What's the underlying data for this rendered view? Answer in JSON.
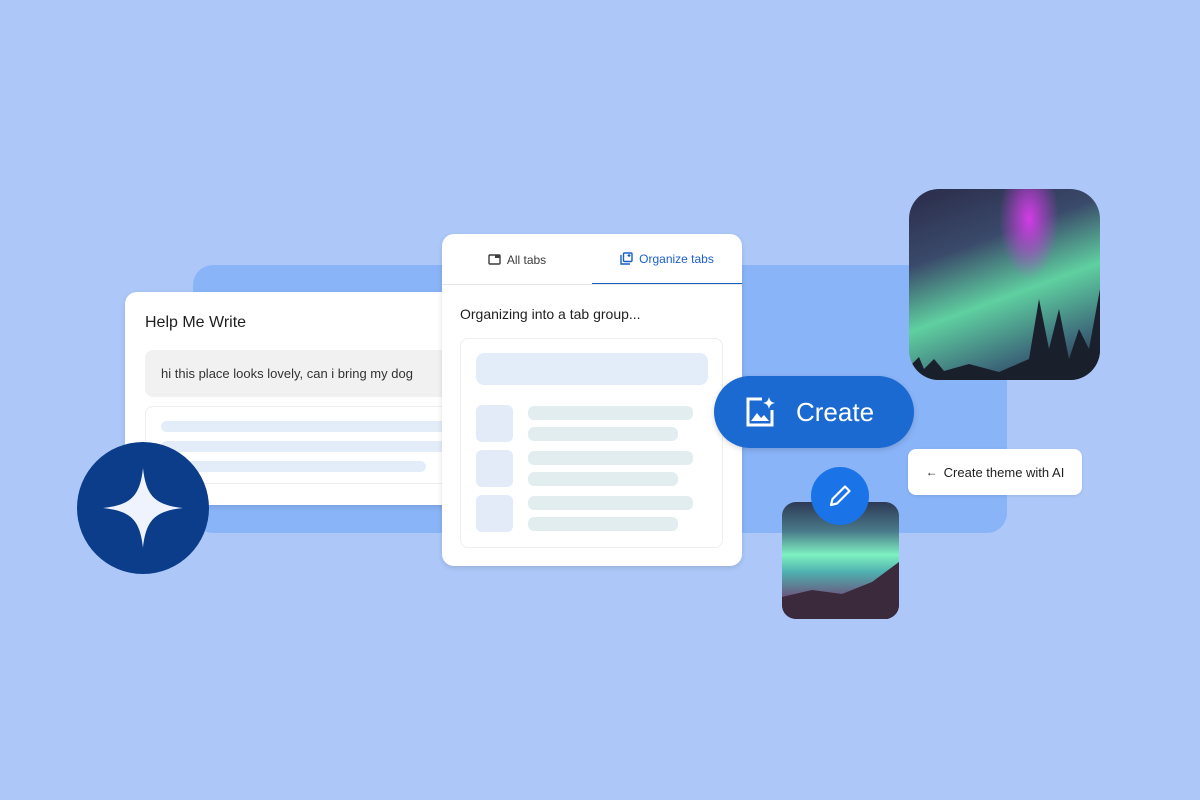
{
  "help_me_write": {
    "title": "Help Me Write",
    "prompt": "hi this place looks lovely, can i bring my dog"
  },
  "tab_panel": {
    "tabs": [
      {
        "label": "All tabs",
        "icon": "tab-icon"
      },
      {
        "label": "Organize tabs",
        "icon": "organize-tabs-icon",
        "active": true
      }
    ],
    "status": "Organizing into a tab group..."
  },
  "create_button": {
    "label": "Create",
    "icon": "image-sparkle-icon"
  },
  "theme_chip": {
    "label": "Create theme with AI",
    "icon": "arrow-left-icon"
  },
  "colors": {
    "background": "#adc8f8",
    "accent": "#1b6ad2",
    "star_circle": "#0b3d8b"
  }
}
